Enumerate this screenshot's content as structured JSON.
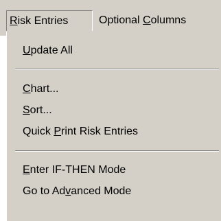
{
  "menubar": {
    "risk_entries": {
      "pre": "",
      "key": "R",
      "post": "isk Entries"
    },
    "optional_columns": {
      "pre": "Optional ",
      "key": "C",
      "post": "olumns"
    }
  },
  "menu": {
    "update_all": {
      "pre": "",
      "key": "U",
      "post": "pdate All"
    },
    "chart": {
      "pre": "",
      "key": "C",
      "post": "hart..."
    },
    "sort": {
      "pre": "",
      "key": "S",
      "post": "ort..."
    },
    "quick_print": {
      "pre": "Quick ",
      "key": "P",
      "post": "rint Risk Entries"
    },
    "enter_if_then": {
      "pre": "",
      "key": "E",
      "post": "nter IF-THEN Mode"
    },
    "advanced_mode": {
      "pre": "Go to Ad",
      "key": "v",
      "post": "anced Mode"
    }
  },
  "colors": {
    "face": "#d4d0c8",
    "shadow": "#808080",
    "highlight": "#ffffff"
  }
}
